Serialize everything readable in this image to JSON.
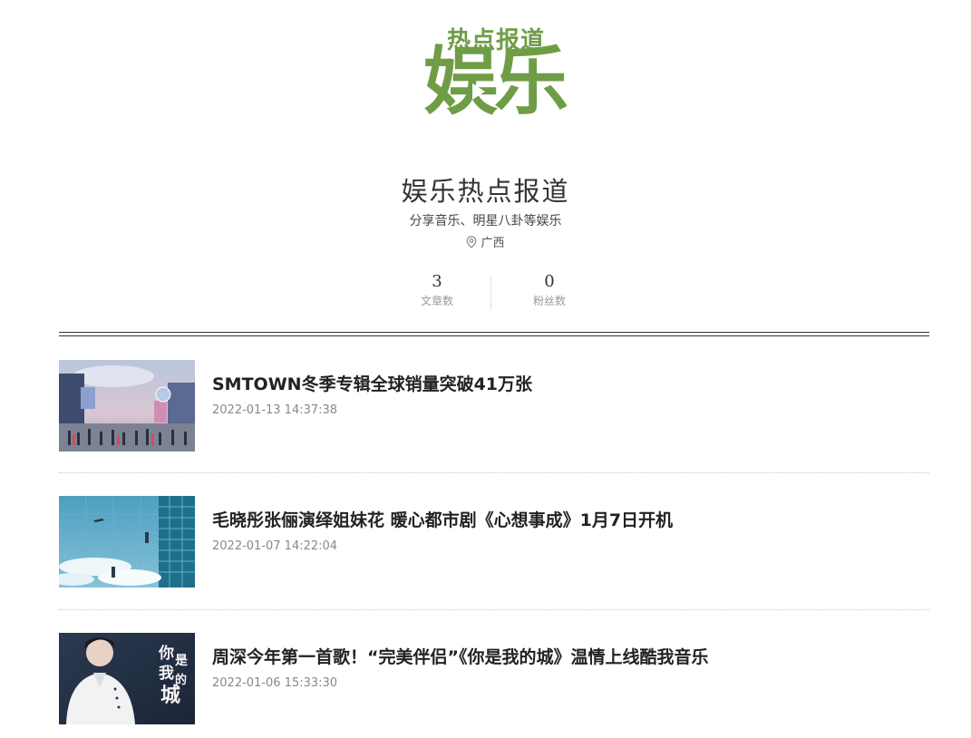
{
  "logo": {
    "top_text": "热点报道",
    "big_text": "娱乐",
    "color": "#6f9d45"
  },
  "profile": {
    "name": "娱乐热点报道",
    "bio": "分享音乐、明星八卦等娱乐",
    "location": "广西",
    "location_icon": "map-pin-icon"
  },
  "stats": [
    {
      "value": "3",
      "label": "文章数"
    },
    {
      "value": "0",
      "label": "粉丝数"
    }
  ],
  "articles": [
    {
      "title": "SMTOWN冬季专辑全球销量突破41万张",
      "date": "2022-01-13 14:37:38"
    },
    {
      "title": "毛晓彤张俪演绎姐妹花 暖心都市剧《心想事成》1月7日开机",
      "date": "2022-01-07 14:22:04"
    },
    {
      "title": "周深今年第一首歌！“完美伴侣”《你是我的城》温情上线酷我音乐",
      "date": "2022-01-06 15:33:30",
      "thumb_text": "你是我的城"
    }
  ]
}
